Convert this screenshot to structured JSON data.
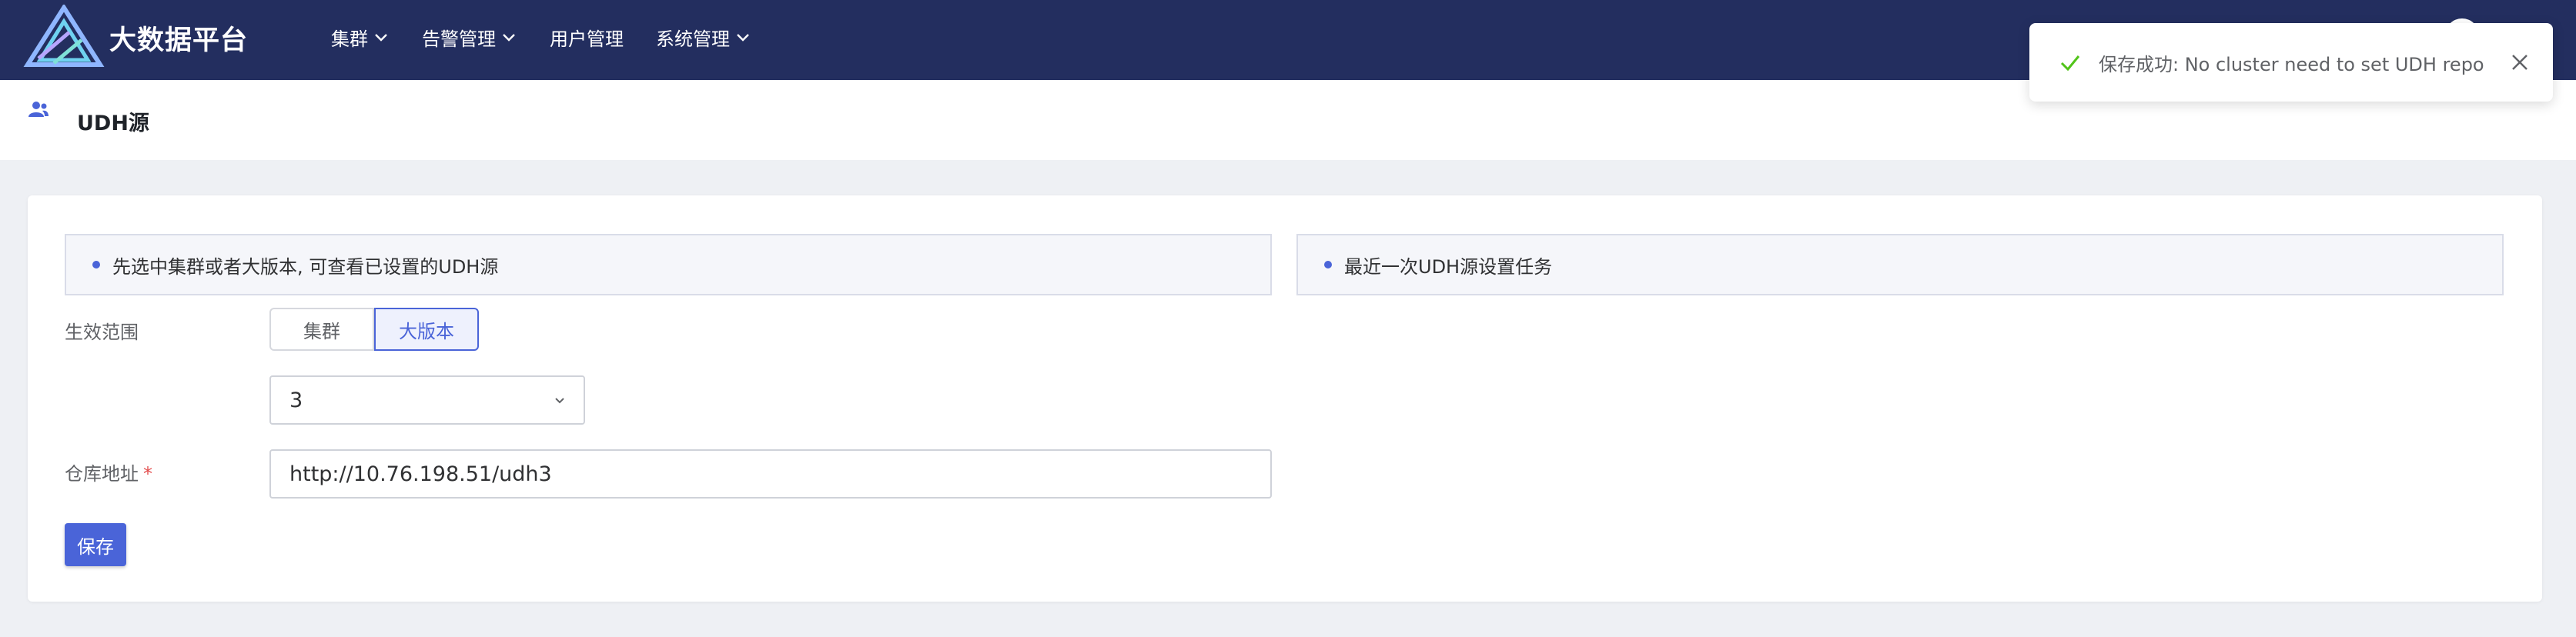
{
  "app": {
    "title": "大数据平台",
    "logo_icon": "delta-logo-icon",
    "colors": {
      "nav_bg": "#232e5f",
      "accent": "#4a64d8",
      "required": "#e34d4d",
      "success": "#52c41a"
    }
  },
  "nav": {
    "items": [
      {
        "label": "集群",
        "dropdown": true
      },
      {
        "label": "告警管理",
        "dropdown": true
      },
      {
        "label": "用户管理",
        "dropdown": false
      },
      {
        "label": "系统管理",
        "dropdown": true
      }
    ]
  },
  "page": {
    "title": "UDH源",
    "icon": "users-icon"
  },
  "info": {
    "left_text": "先选中集群或者大版本, 可查看已设置的UDH源",
    "right_text": "最近一次UDH源设置任务"
  },
  "form": {
    "scope_label": "生效范围",
    "scope_options": [
      "集群",
      "大版本"
    ],
    "scope_selected": "大版本",
    "version_value": "3",
    "repo_label": "仓库地址",
    "repo_required_mark": "*",
    "repo_value": "http://10.76.198.51/udh3",
    "save_label": "保存"
  },
  "toast": {
    "message": "保存成功: No cluster need to set UDH repo",
    "icon": "check-icon",
    "close_icon": "close-icon"
  }
}
